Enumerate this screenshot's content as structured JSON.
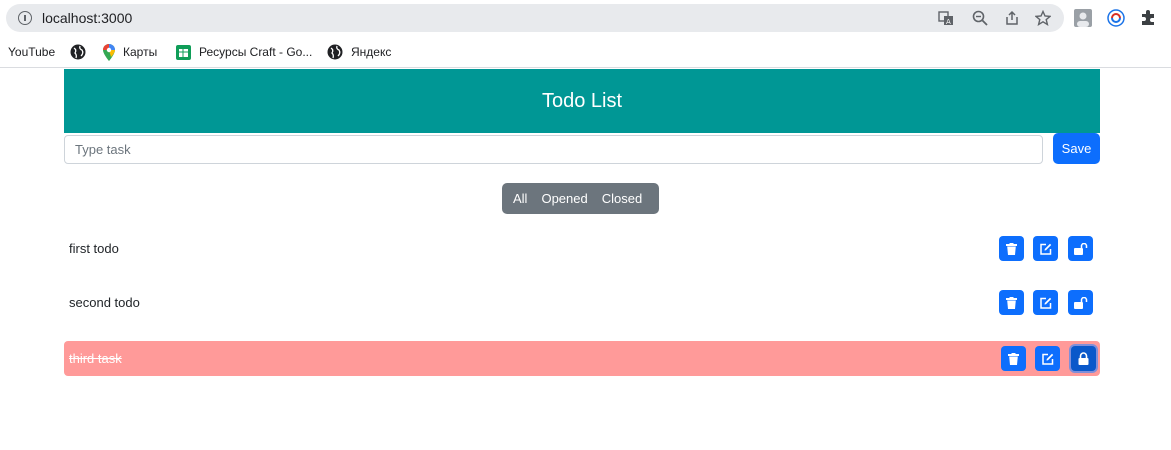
{
  "browser": {
    "url": "localhost:3000",
    "bookmarks": [
      {
        "label": "YouTube",
        "icon": "none"
      },
      {
        "label": "",
        "icon": "globe-icon"
      },
      {
        "label": "Карты",
        "icon": "maps-pin-icon"
      },
      {
        "label": "Ресурсы Craft - Go...",
        "icon": "sheets-icon"
      },
      {
        "label": "Яндекс",
        "icon": "globe-icon"
      }
    ]
  },
  "app": {
    "title": "Todo List",
    "input_placeholder": "Type task",
    "input_value": "",
    "save_label": "Save",
    "filters": [
      "All",
      "Opened",
      "Closed"
    ],
    "colors": {
      "header": "#009795",
      "primary": "#0d6efd",
      "filter_group": "#6c757d",
      "closed_row": "#ff9a99"
    },
    "todos": [
      {
        "text": "first todo",
        "closed": false,
        "lock_icon": "unlock-icon"
      },
      {
        "text": "second todo",
        "closed": false,
        "lock_icon": "unlock-icon"
      },
      {
        "text": "third task",
        "closed": true,
        "lock_icon": "lock-icon"
      }
    ]
  }
}
